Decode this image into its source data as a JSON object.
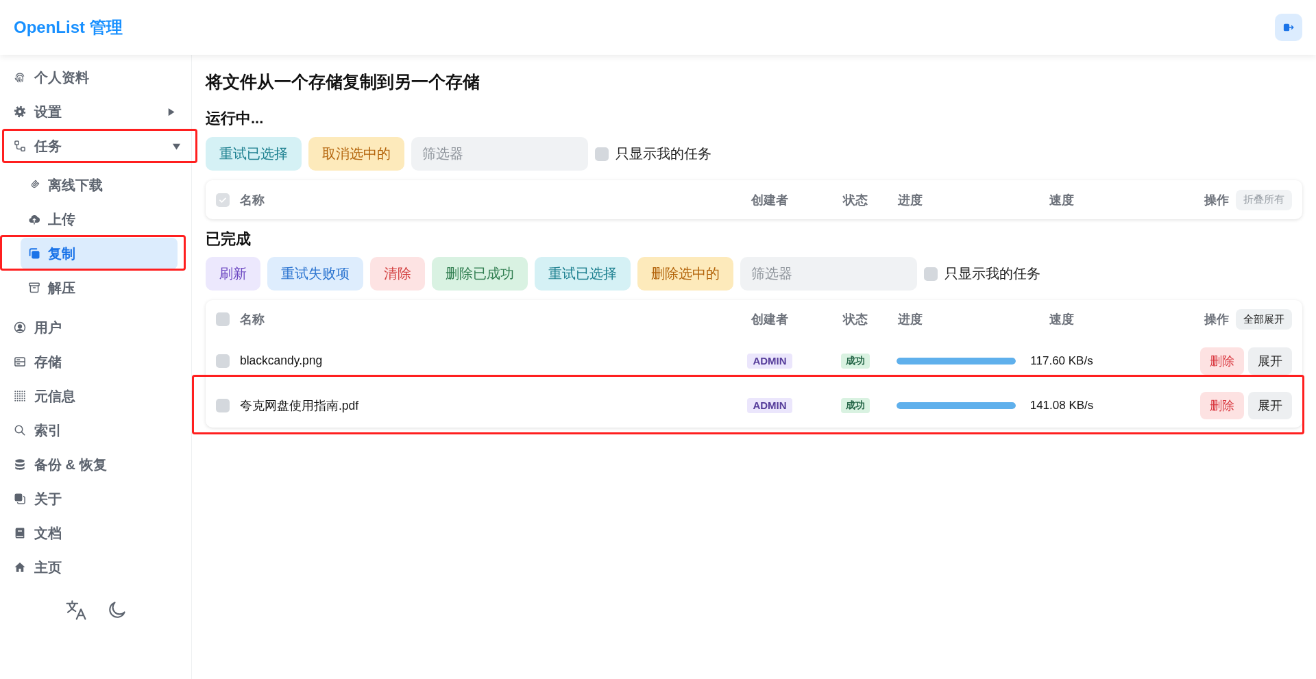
{
  "header": {
    "title": "OpenList 管理"
  },
  "sidebar": {
    "items": [
      {
        "kind": "link",
        "label": "个人资料",
        "selected": false,
        "highlighted": false
      },
      {
        "kind": "group",
        "label": "设置",
        "selected": false,
        "highlighted": false,
        "expanded": false
      },
      {
        "kind": "group",
        "label": "任务",
        "selected": false,
        "highlighted": true,
        "expanded": true,
        "children": [
          {
            "label": "离线下载",
            "selected": false,
            "highlighted": false
          },
          {
            "label": "上传",
            "selected": false,
            "highlighted": false
          },
          {
            "label": "复制",
            "selected": true,
            "highlighted": true
          },
          {
            "label": "解压",
            "selected": false,
            "highlighted": false
          }
        ]
      },
      {
        "kind": "link",
        "label": "用户",
        "selected": false,
        "highlighted": false
      },
      {
        "kind": "link",
        "label": "存储",
        "selected": false,
        "highlighted": false
      },
      {
        "kind": "link",
        "label": "元信息",
        "selected": false,
        "highlighted": false
      },
      {
        "kind": "link",
        "label": "索引",
        "selected": false,
        "highlighted": false
      },
      {
        "kind": "link",
        "label": "备份 & 恢复",
        "selected": false,
        "highlighted": false
      },
      {
        "kind": "link",
        "label": "关于",
        "selected": false,
        "highlighted": false
      },
      {
        "kind": "link",
        "label": "文档",
        "selected": false,
        "highlighted": false
      },
      {
        "kind": "link",
        "label": "主页",
        "selected": false,
        "highlighted": false
      }
    ]
  },
  "page": {
    "title": "将文件从一个存储复制到另一个存储"
  },
  "running": {
    "heading": "运行中...",
    "buttons": [
      {
        "label": "重试已选择",
        "kind": "info"
      },
      {
        "label": "取消选中的",
        "kind": "warning"
      }
    ],
    "filter": {
      "placeholder": "筛选器"
    },
    "only_mine": {
      "label": "只显示我的任务",
      "checked": false
    },
    "table": {
      "select_all": {
        "checked": true,
        "disabled": true
      },
      "columns": [
        "名称",
        "创建者",
        "状态",
        "进度",
        "速度",
        "操作"
      ],
      "header_button": {
        "label": "折叠所有",
        "disabled": true
      }
    }
  },
  "completed": {
    "heading": "已完成",
    "buttons": [
      {
        "label": "刷新",
        "kind": "accent"
      },
      {
        "label": "重试失败项",
        "kind": "primary"
      },
      {
        "label": "清除",
        "kind": "danger"
      },
      {
        "label": "删除已成功",
        "kind": "success"
      },
      {
        "label": "重试已选择",
        "kind": "info"
      },
      {
        "label": "删除选中的",
        "kind": "warning"
      }
    ],
    "filter": {
      "placeholder": "筛选器"
    },
    "only_mine": {
      "label": "只显示我的任务",
      "checked": false
    },
    "table": {
      "select_all": {
        "checked": false,
        "disabled": false
      },
      "columns": [
        "名称",
        "创建者",
        "状态",
        "进度",
        "速度",
        "操作"
      ],
      "header_button": {
        "label": "全部展开",
        "disabled": false
      },
      "rows": [
        {
          "name": "blackcandy.png",
          "creator": "ADMIN",
          "status": "成功",
          "level": 1,
          "speed": "117.60 KB/s",
          "checked": false,
          "highlighted": false,
          "actions": [
            {
              "label": "删除",
              "kind": "danger"
            },
            {
              "label": "展开",
              "kind": "neutral"
            }
          ]
        },
        {
          "name": "夸克网盘使用指南.pdf",
          "creator": "ADMIN",
          "status": "成功",
          "level": 1,
          "speed": "141.08 KB/s",
          "checked": false,
          "highlighted": true,
          "actions": [
            {
              "label": "删除",
              "kind": "danger"
            },
            {
              "label": "展开",
              "kind": "neutral"
            }
          ]
        }
      ]
    }
  }
}
